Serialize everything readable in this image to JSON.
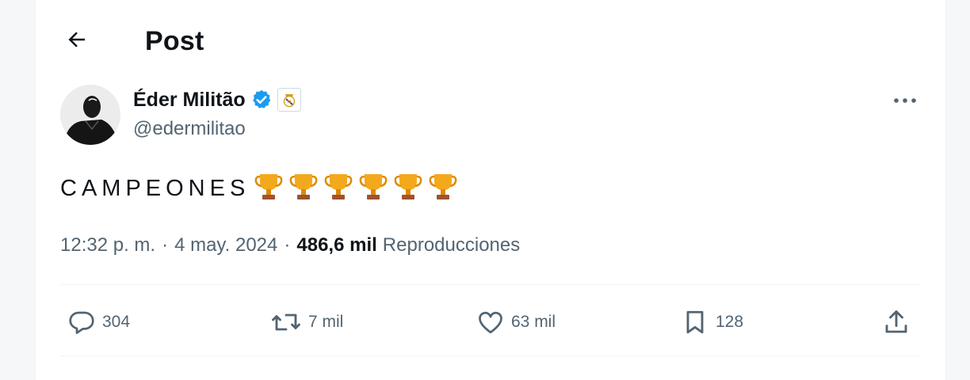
{
  "header": {
    "title": "Post",
    "back_icon": "arrow-left-icon"
  },
  "author": {
    "display_name": "Éder Militão",
    "handle": "@edermilitao",
    "verified_icon": "verified-badge-icon",
    "affiliation_icon": "real-madrid-crest-icon"
  },
  "post": {
    "text": "CAMPEONES",
    "emoji_icons": [
      "trophy-icon",
      "trophy-icon",
      "trophy-icon",
      "trophy-icon",
      "trophy-icon",
      "trophy-icon"
    ],
    "time": "12:32 p. m.",
    "separator": "·",
    "date": "4 may. 2024",
    "views_count": "486,6 mil",
    "views_label": "Reproducciones"
  },
  "actions": {
    "replies": "304",
    "reposts": "7 mil",
    "likes": "63 mil",
    "bookmarks": "128"
  },
  "colors": {
    "text_primary": "#0f1419",
    "text_secondary": "#536471",
    "verified_blue": "#1d9bf0",
    "divider": "#eff3f4",
    "trophy_gold": "#f4a91c"
  }
}
